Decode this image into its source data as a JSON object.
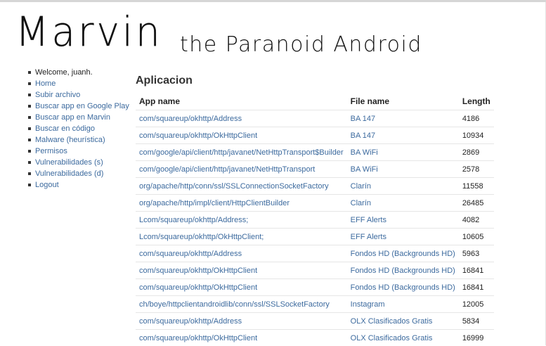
{
  "header": {
    "logo": "Marvin",
    "tagline": "the Paranoid Android"
  },
  "sidebar": {
    "welcome": "Welcome, juanh.",
    "items": [
      {
        "label": "Home"
      },
      {
        "label": "Subir archivo"
      },
      {
        "label": "Buscar app en Google Play"
      },
      {
        "label": "Buscar app en Marvin"
      },
      {
        "label": "Buscar en código"
      },
      {
        "label": "Malware (heurística)"
      },
      {
        "label": "Permisos"
      },
      {
        "label": "Vulnerabilidades (s)"
      },
      {
        "label": "Vulnerabilidades (d)"
      },
      {
        "label": "Logout"
      }
    ]
  },
  "main": {
    "title": "Aplicacion",
    "columns": [
      "App name",
      "File name",
      "Length"
    ],
    "rows": [
      {
        "app": "com/squareup/okhttp/Address",
        "file": "BA 147",
        "length": "4186"
      },
      {
        "app": "com/squareup/okhttp/OkHttpClient",
        "file": "BA 147",
        "length": "10934"
      },
      {
        "app": "com/google/api/client/http/javanet/NetHttpTransport$Builder",
        "file": "BA WiFi",
        "length": "2869"
      },
      {
        "app": "com/google/api/client/http/javanet/NetHttpTransport",
        "file": "BA WiFi",
        "length": "2578"
      },
      {
        "app": "org/apache/http/conn/ssl/SSLConnectionSocketFactory",
        "file": "Clarín",
        "length": "11558"
      },
      {
        "app": "org/apache/http/impl/client/HttpClientBuilder",
        "file": "Clarín",
        "length": "26485"
      },
      {
        "app": "Lcom/squareup/okhttp/Address;",
        "file": "EFF Alerts",
        "length": "4082"
      },
      {
        "app": "Lcom/squareup/okhttp/OkHttpClient;",
        "file": "EFF Alerts",
        "length": "10605"
      },
      {
        "app": "com/squareup/okhttp/Address",
        "file": "Fondos HD (Backgrounds HD)",
        "length": "5963"
      },
      {
        "app": "com/squareup/okhttp/OkHttpClient",
        "file": "Fondos HD (Backgrounds HD)",
        "length": "16841"
      },
      {
        "app": "com/squareup/okhttp/OkHttpClient",
        "file": "Fondos HD (Backgrounds HD)",
        "length": "16841"
      },
      {
        "app": "ch/boye/httpclientandroidlib/conn/ssl/SSLSocketFactory",
        "file": "Instagram",
        "length": "12005"
      },
      {
        "app": "com/squareup/okhttp/Address",
        "file": "OLX Clasificados Gratis",
        "length": "5834"
      },
      {
        "app": "com/squareup/okhttp/OkHttpClient",
        "file": "OLX Clasificados Gratis",
        "length": "16999"
      }
    ]
  }
}
